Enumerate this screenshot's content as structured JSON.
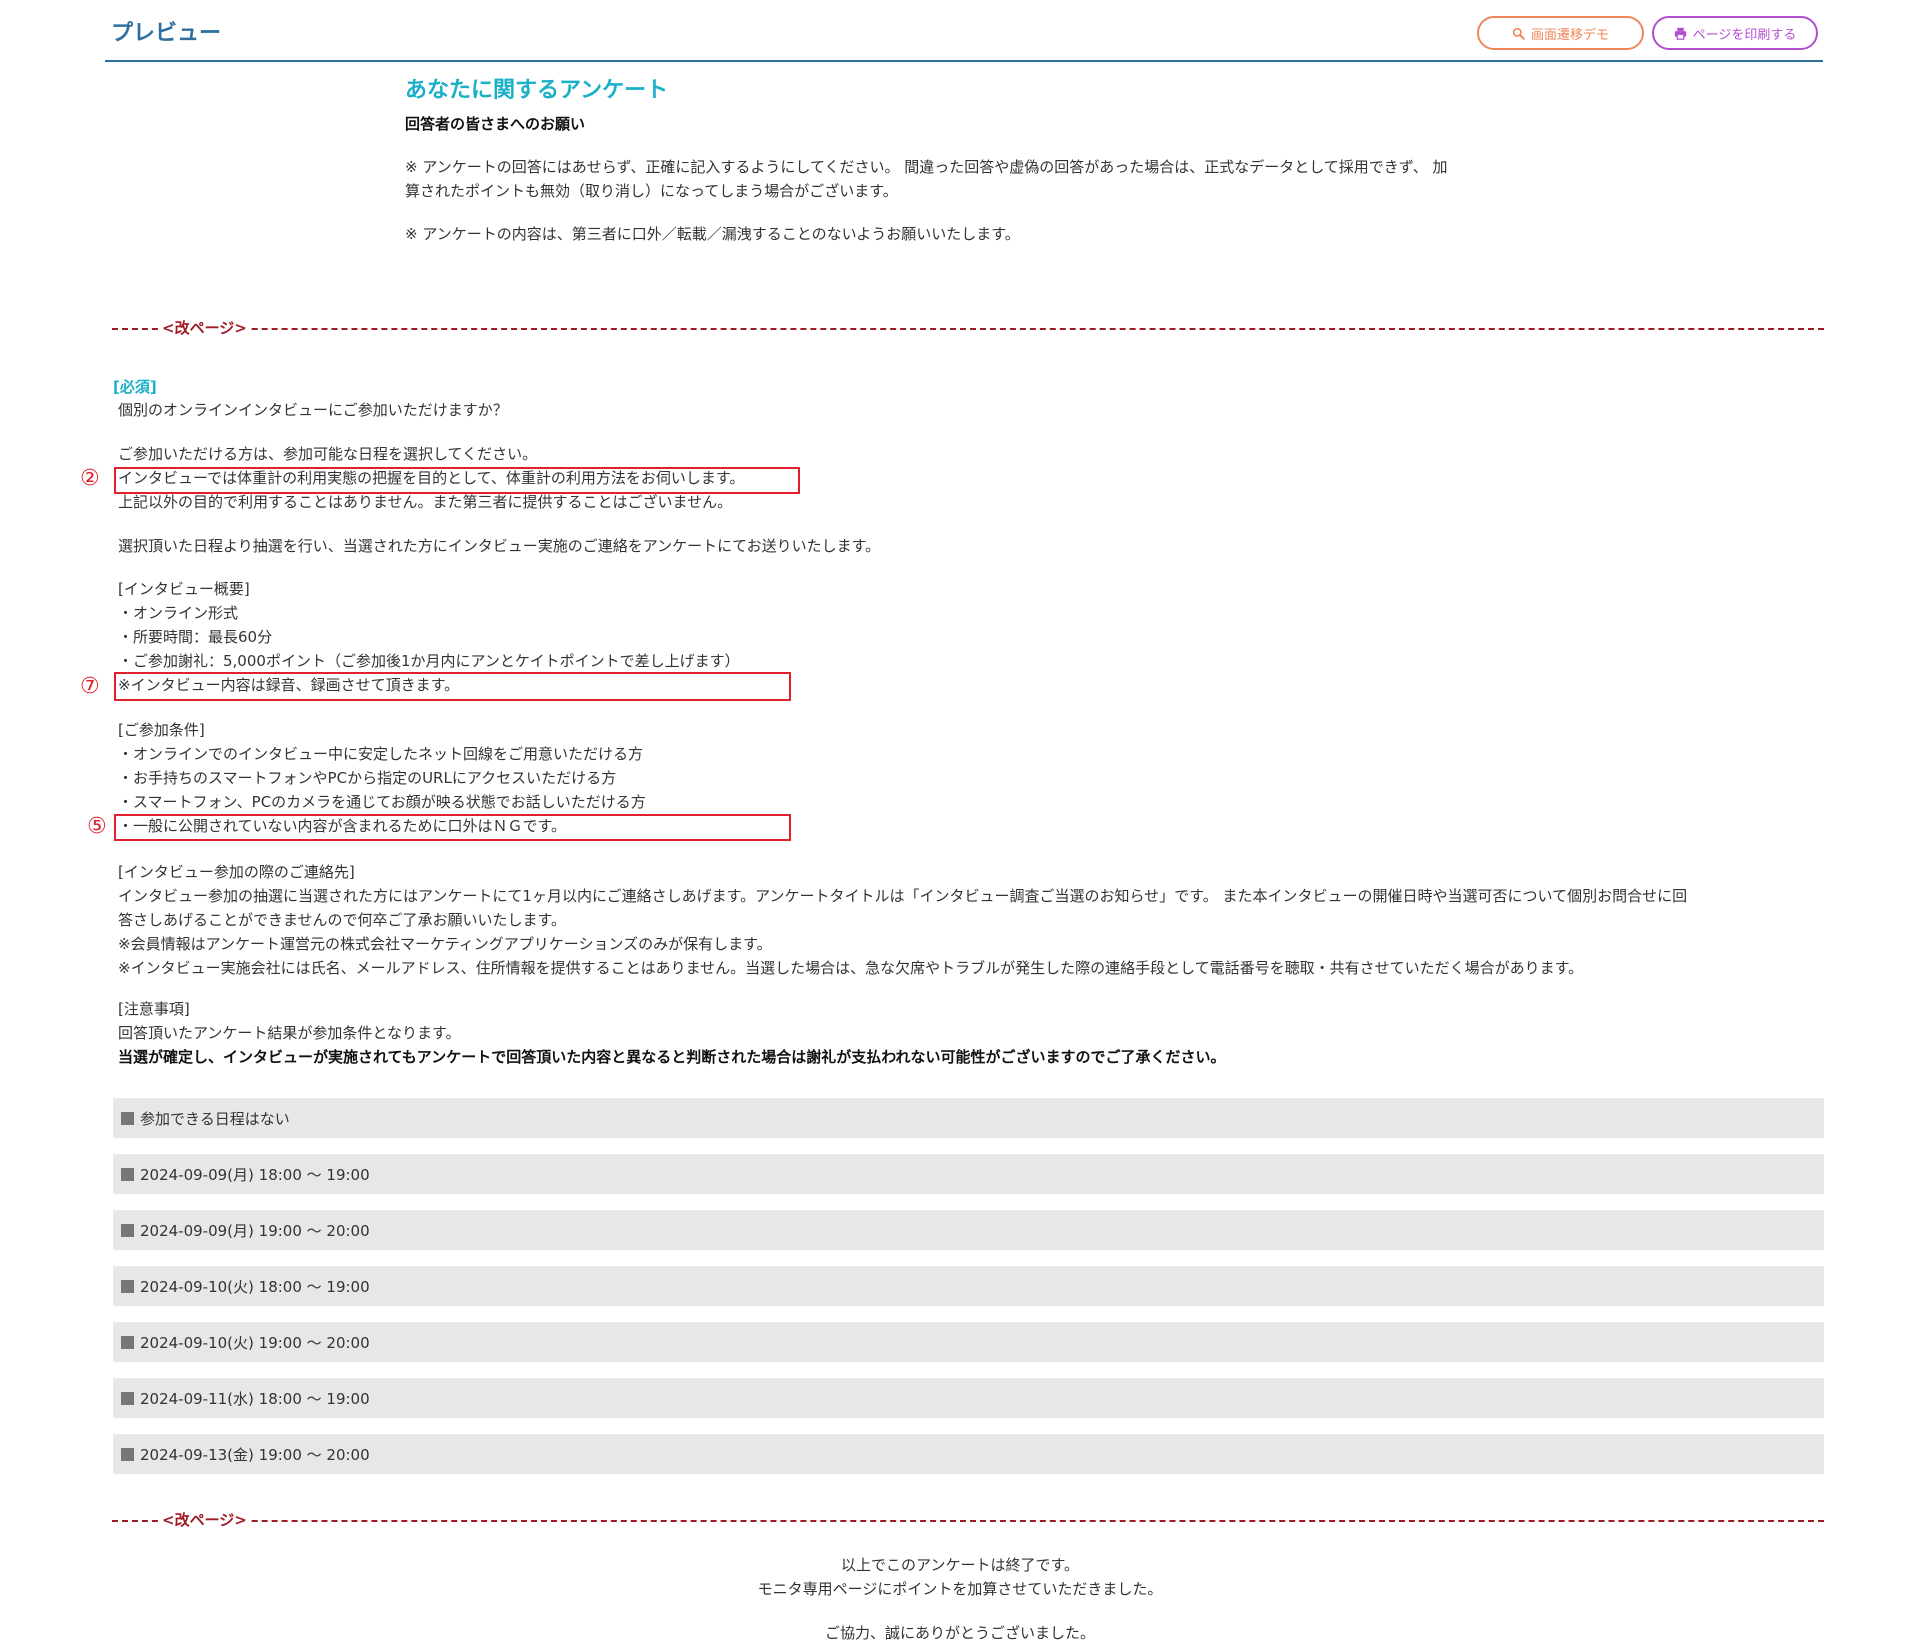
{
  "header": {
    "title": "プレビュー",
    "demo_button": "画面遷移デモ",
    "print_button": "ページを印刷する"
  },
  "intro": {
    "title": "あなたに関するアンケート",
    "heading": "回答者の皆さまへのお願い",
    "p1_line1": "※ アンケートの回答にはあせらず、正確に記入するようにしてください。 間違った回答や虚偽の回答があった場合は、正式なデータとして採用できず、 加",
    "p1_line2": "算されたポイントも無効（取り消し）になってしまう場合がございます。",
    "p2": "※ アンケートの内容は、第三者に口外／転載／漏洩することのないようお願いいたします。"
  },
  "page_break_label": "<改ページ>",
  "question": {
    "required": "[必須]",
    "line_q": "個別のオンラインインタビューにご参加いただけますか？",
    "line_a1": "ご参加いただける方は、参加可能な日程を選択してください。",
    "line_a2": "インタビューでは体重計の利用実態の把握を目的として、体重計の利用方法をお伺いします。",
    "line_a3": "上記以外の目的で利用することはありません。また第三者に提供することはございません。",
    "line_b1": "選択頂いた日程より抽選を行い、当選された方にインタビュー実施のご連絡をアンケートにてお送りいたします。",
    "line_c1": "[インタビュー概要]",
    "line_c2": "・オンライン形式",
    "line_c3": "・所要時間：最長60分",
    "line_c4": "・ご参加謝礼：5,000ポイント（ご参加後1か月内にアンとケイトポイントで差し上げます）",
    "line_c5": "※インタビュー内容は録音、録画させて頂きます。",
    "line_d1": "[ご参加条件]",
    "line_d2": "・オンラインでのインタビュー中に安定したネット回線をご用意いただける方",
    "line_d3": "・お手持ちのスマートフォンやPCから指定のURLにアクセスいただける方",
    "line_d4": "・スマートフォン、PCのカメラを通じてお顔が映る状態でお話しいただける方",
    "line_d5": "・一般に公開されていない内容が含まれるために口外はＮＧです。",
    "line_e1": "[インタビュー参加の際のご連絡先]",
    "line_e2": "インタビュー参加の抽選に当選された方にはアンケートにて1ヶ月以内にご連絡さしあげます。アンケートタイトルは「インタビュー調査ご当選のお知らせ」です。 また本インタビューの開催日時や当選可否について個別お問合せに回",
    "line_e3": "答さしあげることができませんので何卒ご了承お願いいたします。",
    "line_e4": "※会員情報はアンケート運営元の株式会社マーケティングアプリケーションズのみが保有します。",
    "line_e5": "※インタビュー実施会社には氏名、メールアドレス、住所情報を提供することはありません。当選した場合は、急な欠席やトラブルが発生した際の連絡手段として電話番号を聴取・共有させていただく場合があります。",
    "line_f1": "[注意事項]",
    "line_f2": "回答頂いたアンケート結果が参加条件となります。",
    "line_f3": "当選が確定し、インタビューが実施されてもアンケートで回答頂いた内容と異なると判断された場合は謝礼が支払われない可能性がございますのでご了承ください。"
  },
  "markers": {
    "m2": "②",
    "m7": "⑦",
    "m5": "⑤"
  },
  "options": [
    "参加できる日程はない",
    "2024-09-09(月) 18:00 〜 19:00",
    "2024-09-09(月) 19:00 〜 20:00",
    "2024-09-10(火) 18:00 〜 19:00",
    "2024-09-10(火) 19:00 〜 20:00",
    "2024-09-11(水) 18:00 〜 19:00",
    "2024-09-13(金) 19:00 〜 20:00"
  ],
  "ending": {
    "line1": "以上でこのアンケートは終了です。",
    "line2": "モニタ専用ページにポイントを加算させていただきました。",
    "line3": "ご協力、誠にありがとうございました。"
  }
}
